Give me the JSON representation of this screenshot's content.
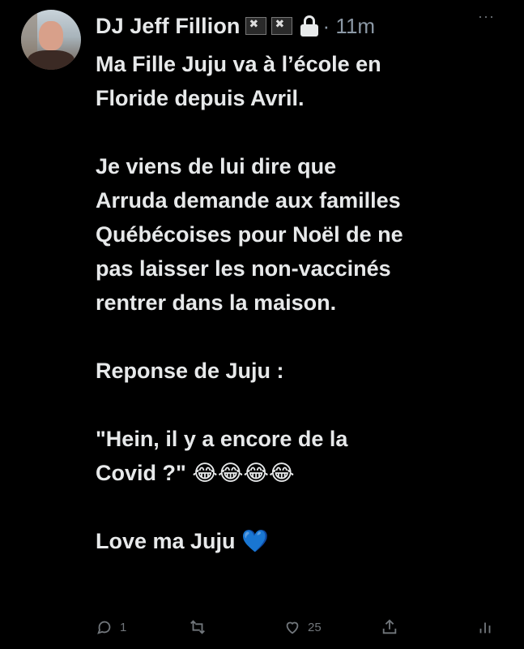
{
  "tweet": {
    "author_name": "DJ Jeff Fillion",
    "time_ago": "· 11m",
    "lines": [
      "Ma Fille Juju va à l’école en",
      "Floride depuis Avril.",
      "",
      "Je viens de lui dire que",
      "Arruda demande aux familles",
      "Québécoises pour Noël de ne",
      "pas laisser les non-vaccinés",
      "rentrer dans la maison.",
      "",
      "Reponse de Juju :",
      "",
      "\"Hein, il y a encore de la",
      "Covid ?\" 😂😂😂😂",
      "",
      "Love ma Juju 💙"
    ]
  },
  "actions": {
    "reply_count": "1",
    "retweet_count": "",
    "like_count": "25"
  },
  "icons": [
    "pirate-flag-icon",
    "lock-icon",
    "more-icon",
    "reply-icon",
    "retweet-icon",
    "like-icon",
    "share-icon",
    "analytics-icon"
  ],
  "colors": {
    "background": "#000000",
    "text": "#e7e9ea",
    "muted": "#71767b"
  }
}
